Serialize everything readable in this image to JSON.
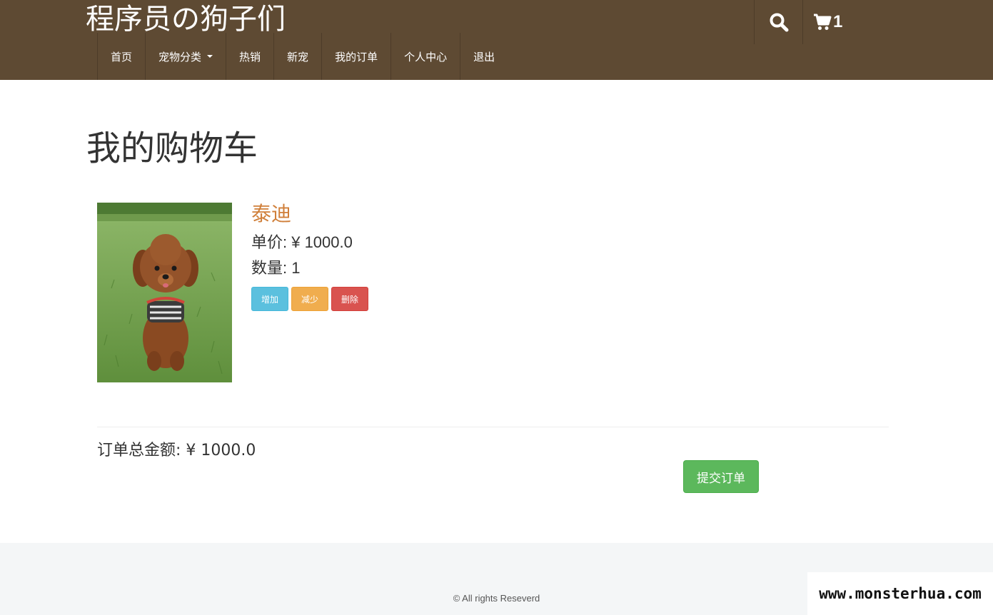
{
  "header": {
    "brand": "程序员の狗子们",
    "cart_count": "1",
    "icons": {
      "search": "search-icon",
      "cart": "cart-icon"
    },
    "nav": [
      {
        "label": "首页"
      },
      {
        "label": "宠物分类",
        "dropdown": true
      },
      {
        "label": "热销"
      },
      {
        "label": "新宠"
      },
      {
        "label": "我的订单"
      },
      {
        "label": "个人中心"
      },
      {
        "label": "退出"
      }
    ]
  },
  "main": {
    "title": "我的购物车",
    "cart_items": [
      {
        "name": "泰迪",
        "price_line": "单价: ¥ 1000.0",
        "qty_line": "数量: 1",
        "buttons": {
          "increase": "增加",
          "decrease": "减少",
          "delete": "删除"
        }
      }
    ],
    "total_line": "订单总金额: ¥ 1000.0",
    "submit_label": "提交订单"
  },
  "footer": {
    "copyright": "© All rights Reseverd"
  },
  "watermark": "www.monsterhua.com",
  "colors": {
    "header_bg": "#5e4a33",
    "product_name": "#d07f3a",
    "btn_info": "#5bc0de",
    "btn_warning": "#f0ad4e",
    "btn_danger": "#d9534f",
    "btn_success": "#5cb85c",
    "footer_bg": "#f4f6f7"
  }
}
